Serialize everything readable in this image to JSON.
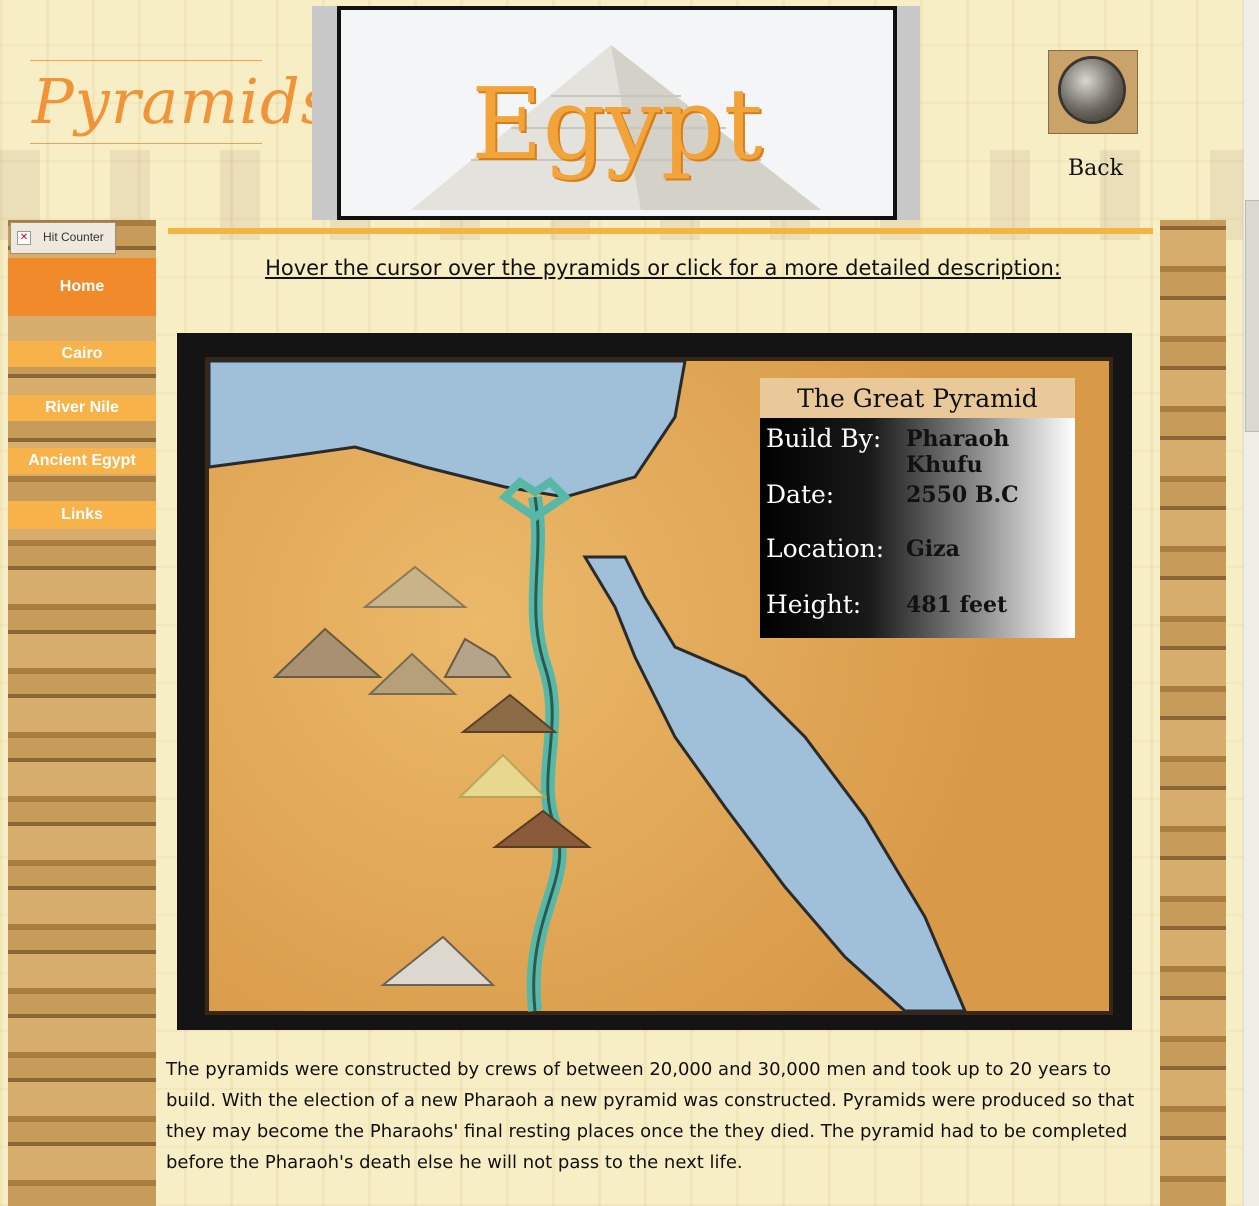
{
  "header": {
    "site_logo": "Pyramids",
    "banner_title": "Egypt",
    "back_label": "Back"
  },
  "sidebar": {
    "hit_counter_label": "Hit Counter",
    "nav": [
      {
        "label": "Home"
      },
      {
        "label": "Cairo"
      },
      {
        "label": "River Nile"
      },
      {
        "label": "Ancient Egypt"
      },
      {
        "label": "Links"
      }
    ]
  },
  "main": {
    "instruction": "Hover the cursor over the pyramids or click for a more detailed description:",
    "info_box": {
      "title": "The Great Pyramid",
      "rows": [
        {
          "key": "Build By:",
          "value": "Pharaoh Khufu"
        },
        {
          "key": "Date:",
          "value": "2550 B.C"
        },
        {
          "key": "Location:",
          "value": "Giza"
        },
        {
          "key": "Height:",
          "value": "481 feet"
        }
      ]
    },
    "description": "The pyramids were constructed by crews of between 20,000 and 30,000 men and took up to 20 years to build. With the election of a new Pharaoh a new pyramid was constructed. Pyramids were produced so that they may become the Pharaohs' final resting places once the they died. The pyramid had to be completed before the Pharaoh's death else he will not pass to the next life."
  },
  "colors": {
    "accent_orange": "#f08a2a",
    "nav_orange": "#f7b34a",
    "sea_blue": "#9fbfd8",
    "nile_teal": "#58b8a8"
  }
}
